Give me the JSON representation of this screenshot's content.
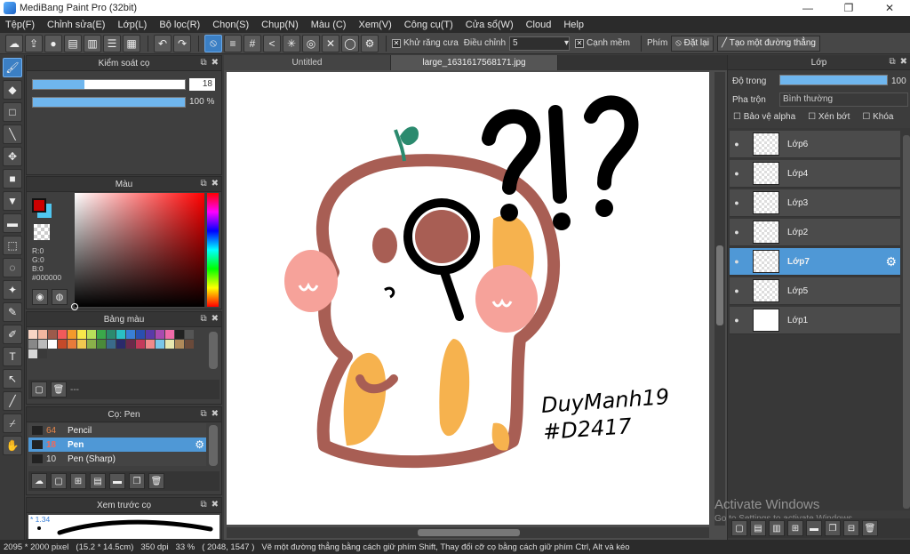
{
  "window": {
    "title": "MediBang Paint Pro (32bit)",
    "minimize": "—",
    "maximize": "❐",
    "close": "✕"
  },
  "menu": [
    "Tệp(F)",
    "Chỉnh sửa(E)",
    "Lớp(L)",
    "Bộ lọc(R)",
    "Chọn(S)",
    "Chụp(N)",
    "Màu (C)",
    "Xem(V)",
    "Công cụ(T)",
    "Cửa sổ(W)",
    "Cloud",
    "Help"
  ],
  "toolbar": {
    "antialias_label": "Khử răng cưa",
    "adjust_label": "Điều chỉnh",
    "adjust_value": "5",
    "soft_edge_label": "Cạnh mềm",
    "key_label": "Phím",
    "reset_label": "Đặt lại",
    "line_label": "Tạo một đường thẳng"
  },
  "brush_control": {
    "title": "Kiểm soát cọ",
    "size": "18",
    "size_fraction": 0.34,
    "opacity": "100 %",
    "opacity_fraction": 1.0
  },
  "color_panel": {
    "title": "Màu",
    "r": "R:0",
    "g": "G:0",
    "b": "B:0",
    "hex": "#000000",
    "primary": "#cc0000",
    "secondary": "#4fc6f0"
  },
  "palette": {
    "title": "Bảng màu",
    "colors": [
      "#f7d4c4",
      "#f2b6a0",
      "#9c5a4b",
      "#f05a5a",
      "#f39a2b",
      "#f7e84a",
      "#b7e05a",
      "#3aa84a",
      "#2b8a6e",
      "#2ac0c4",
      "#3a7fd6",
      "#2a4fb0",
      "#5a3aa8",
      "#a84ab0",
      "#f06aa8",
      "#222222",
      "#555555",
      "#888888",
      "#bbbbbb",
      "#ffffff",
      "#c44a2a",
      "#e87a3a",
      "#f0c850",
      "#8ab04a",
      "#4a8a3a",
      "#3a6a8a",
      "#2a2a6a",
      "#6a2a4a",
      "#c43a5a",
      "#f08a8a",
      "#7ac6e8",
      "#e8e8b0",
      "#b08a5a",
      "#6a4a3a",
      "#d8d8d8",
      "#3a3a3a"
    ],
    "footer": "---"
  },
  "brush_list": {
    "title": "Cọ: Pen",
    "items": [
      {
        "size": "64",
        "name": "Pencil"
      },
      {
        "size": "18",
        "name": "Pen"
      },
      {
        "size": "10",
        "name": "Pen (Sharp)"
      }
    ]
  },
  "preview": {
    "title": "Xem trước cọ",
    "size": "* 1.34"
  },
  "tabs": [
    "Untitled",
    "large_1631617568171.jpg"
  ],
  "layers": {
    "title": "Lớp",
    "opacity_label": "Độ trong",
    "opacity_value": "100",
    "opacity_fraction": 1.0,
    "blend_label": "Pha trộn",
    "blend_value": "Bình thường",
    "protect_alpha": "Bảo vệ alpha",
    "clipping": "Xén bớt",
    "lock": "Khóa",
    "items": [
      "Lớp6",
      "Lớp4",
      "Lớp3",
      "Lớp2",
      "Lớp7",
      "Lớp5",
      "Lớp1"
    ],
    "selected": "Lớp7"
  },
  "watermark": {
    "line1": "Activate Windows",
    "line2": "Go to Settings to activate Windows."
  },
  "status": {
    "pixels": "2095 * 2000 pixel",
    "cm": "(15.2 * 14.5cm)",
    "dpi": "350 dpi",
    "zoom": "33 %",
    "coords": "( 2048, 1547 )",
    "hint": "Vẽ một đường thẳng bằng cách giữ phím Shift, Thay đổi cỡ cọ bằng cách giữ phím Ctrl, Alt và kéo"
  },
  "artwork": {
    "signature_line1": "DuyManh19",
    "signature_line2": "#D2417",
    "text": "?!?"
  }
}
